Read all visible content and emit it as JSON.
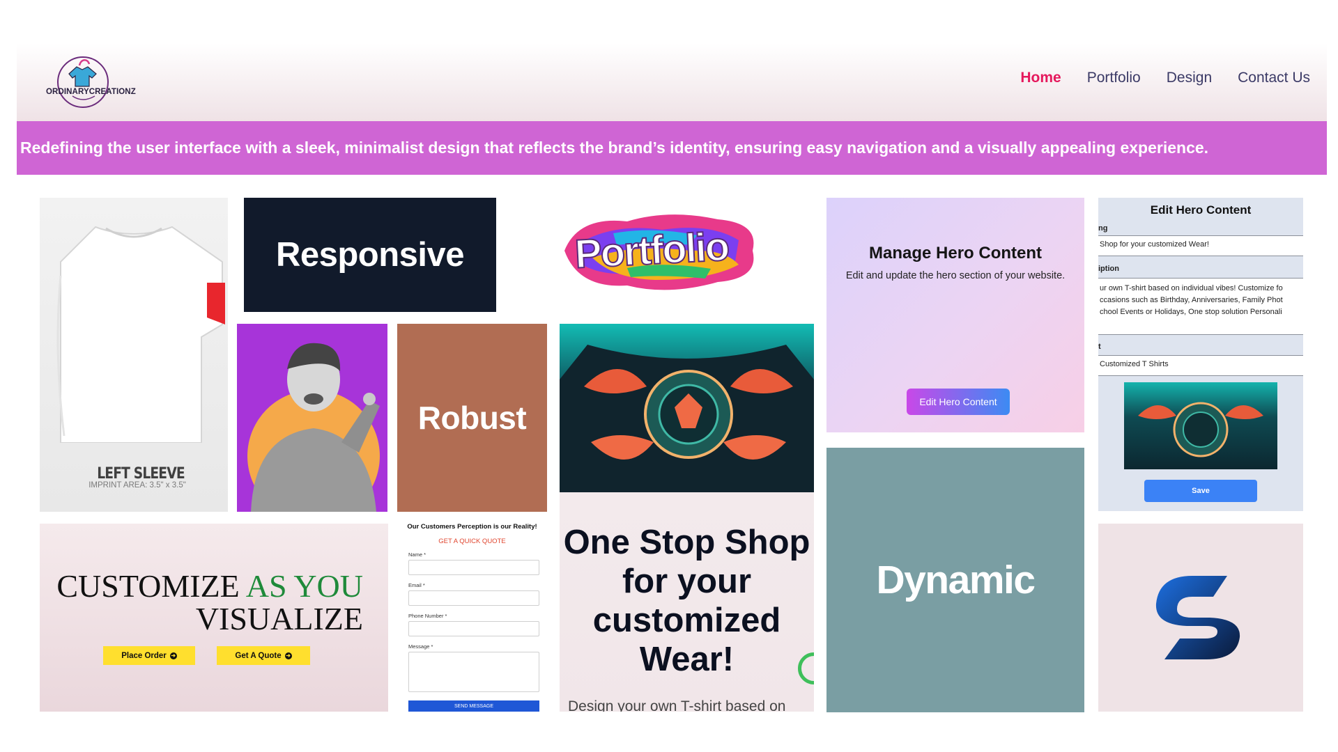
{
  "header": {
    "logo_text": "ORDINARYCREATIONZ",
    "nav": [
      {
        "label": "Home",
        "active": true
      },
      {
        "label": "Portfolio",
        "active": false
      },
      {
        "label": "Design",
        "active": false
      },
      {
        "label": "Contact Us",
        "active": false
      }
    ]
  },
  "banner": {
    "text": "Redefining the user interface with a sleek, minimalist design that reflects the brand’s identity, ensuring easy navigation and a visually appealing experience."
  },
  "tiles": {
    "tshirt": {
      "label": "LEFT SLEEVE",
      "imprint": "IMPRINT AREA: 3.5\" x 3.5\""
    },
    "responsive": "Responsive",
    "portfolio": "Portfolio",
    "robust": "Robust",
    "dynamic": "Dynamic",
    "manage_hero": {
      "title": "Manage Hero Content",
      "description": "Edit and update the hero section of your website.",
      "button": "Edit Hero Content"
    },
    "edit_hero_panel": {
      "title": "Edit Hero Content",
      "heading_label": "ng",
      "heading_value": "Shop for your customized Wear!",
      "description_label": "iption",
      "description_lines": [
        "ur own T-shirt based on individual vibes! Customize fo",
        "ccasions such as Birthday, Anniversaries, Family Phot",
        "chool Events or Holidays, One stop solution Personali"
      ],
      "button_text_label": "t",
      "button_text_value": "Customized T Shirts",
      "save": "Save"
    },
    "customize": {
      "line1_part1": "CUSTOMIZE ",
      "line1_part2": "AS YOU",
      "line2": "VISUALIZE",
      "place_order": "Place Order",
      "get_quote": "Get A Quote",
      "accent_color": "#1f8a3a",
      "button_color": "#ffdf2e"
    },
    "quote_form": {
      "heading": "Our Customers Perception is our Reality!",
      "subheading": "GET A QUICK QUOTE",
      "fields": {
        "name": "Name *",
        "email": "Email *",
        "phone": "Phone Number *",
        "message": "Message *"
      },
      "submit": "SEND MESSAGE"
    },
    "one_stop": {
      "headline_lines": [
        "One Stop Shop",
        "for your",
        "customized",
        "Wear!"
      ],
      "subtext": "Design your own T-shirt based on"
    }
  },
  "colors": {
    "nav_active": "#e5195d",
    "nav_default": "#3b3a66",
    "banner_bg": "#cf65d4",
    "responsive_bg": "#111a2b",
    "robust_bg": "#b16d53",
    "dynamic_bg": "#7a9ea3",
    "save_button": "#3b82f6"
  }
}
